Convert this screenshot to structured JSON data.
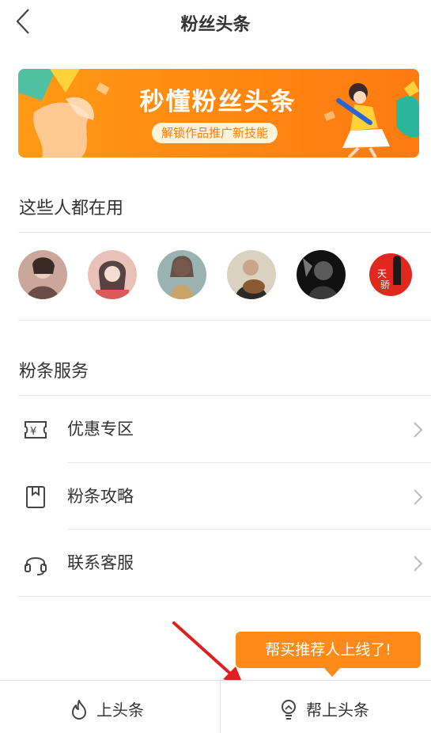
{
  "header": {
    "title": "粉丝头条"
  },
  "banner": {
    "title": "秒懂粉丝头条",
    "subtitle": "解锁作品推广新技能"
  },
  "users_section": {
    "title": "这些人都在用"
  },
  "avatars": [
    {
      "name": "user-avatar-1",
      "colors": [
        "#caa79a",
        "#6b4d48"
      ]
    },
    {
      "name": "user-avatar-2",
      "colors": [
        "#e8c2b8",
        "#3b2b2b"
      ]
    },
    {
      "name": "user-avatar-3",
      "colors": [
        "#9ab3b0",
        "#c9a36a"
      ]
    },
    {
      "name": "user-avatar-4",
      "colors": [
        "#6d7a66",
        "#2a2a28"
      ]
    },
    {
      "name": "user-avatar-5",
      "colors": [
        "#3a3a3a",
        "#111111"
      ]
    },
    {
      "name": "user-avatar-6",
      "colors": [
        "#e0281e",
        "#ffffff"
      ]
    }
  ],
  "services_section": {
    "title": "粉条服务",
    "items": [
      {
        "label": "优惠专区",
        "icon": "coupon-icon"
      },
      {
        "label": "粉条攻略",
        "icon": "bookmark-icon"
      },
      {
        "label": "联系客服",
        "icon": "headset-icon"
      }
    ]
  },
  "tooltip": {
    "text": "帮买推荐人上线了!"
  },
  "tabbar": {
    "tabs": [
      {
        "label": "上头条",
        "icon": "flame-icon"
      },
      {
        "label": "帮上头条",
        "icon": "lightbulb-icon"
      }
    ]
  },
  "colors": {
    "accent": "#ff8a1a",
    "arrow": "#e02020",
    "divider": "#e8e8e8"
  }
}
